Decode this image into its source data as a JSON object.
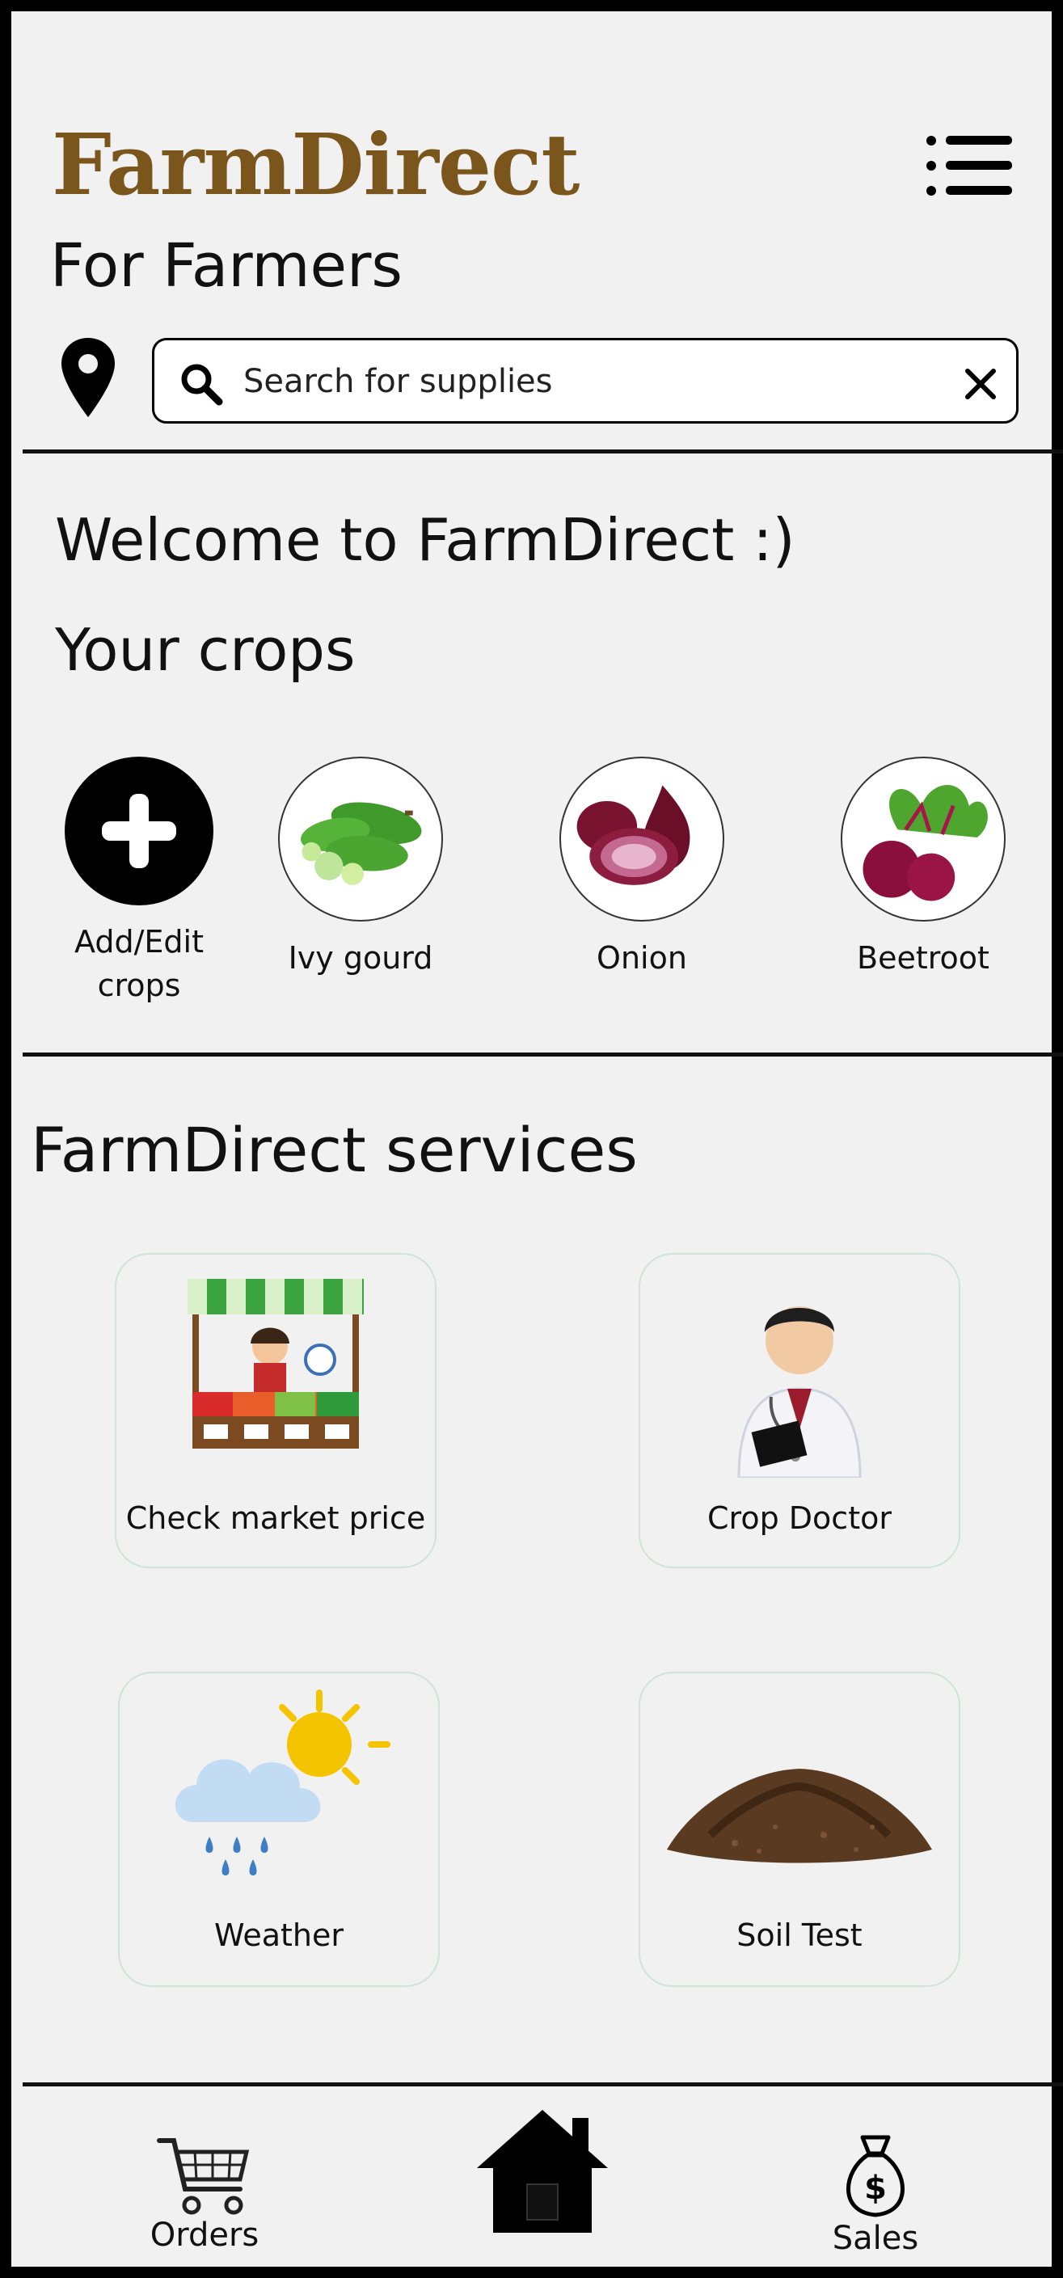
{
  "header": {
    "brand": "FarmDirect",
    "subtitle": "For Farmers",
    "menu_icon": "menu-list-icon",
    "location_icon": "map-pin-icon"
  },
  "search": {
    "placeholder": "Search for supplies",
    "value": ""
  },
  "crops_section": {
    "welcome": "Welcome to FarmDirect :)",
    "title": "Your crops",
    "items": [
      {
        "label_line1": "Add/Edit",
        "label_line2": "crops",
        "icon": "plus-icon"
      },
      {
        "label_line1": "Ivy gourd",
        "icon": "ivy-gourd-image"
      },
      {
        "label_line1": "Onion",
        "icon": "onion-image"
      },
      {
        "label_line1": "Beetroot",
        "icon": "beetroot-image"
      }
    ]
  },
  "services": {
    "title": "FarmDirect services",
    "items": [
      {
        "label": "Check market price",
        "icon": "market-stall-image"
      },
      {
        "label": "Crop Doctor",
        "icon": "doctor-image"
      },
      {
        "label": "Weather",
        "icon": "rain-cloud-sun-icon"
      },
      {
        "label": "Soil Test",
        "icon": "soil-pile-image"
      }
    ]
  },
  "bottom_nav": {
    "items": [
      {
        "label": "Orders",
        "icon": "shopping-cart-icon"
      },
      {
        "label": "",
        "icon": "home-icon"
      },
      {
        "label": "Sales",
        "icon": "money-bag-icon"
      }
    ]
  },
  "colors": {
    "brand": "#7a551c",
    "background": "#f1f1f1",
    "card_border": "#cfe3d9"
  }
}
